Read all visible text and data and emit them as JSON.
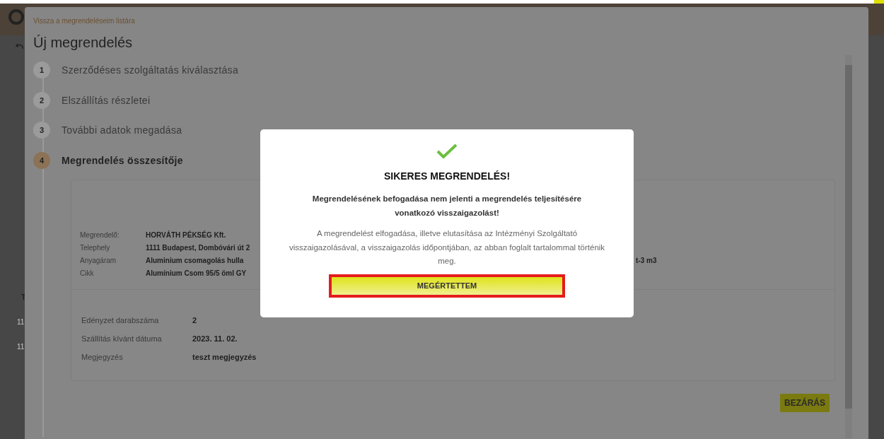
{
  "background": {
    "table_header": "T",
    "table_rows": [
      "11",
      "11"
    ]
  },
  "dialog": {
    "back_link": "Vissza a megrendeléseim listára",
    "title": "Új megrendelés",
    "steps": [
      {
        "number": "1",
        "label": "Szerződéses szolgáltatás kiválasztása",
        "selected": false
      },
      {
        "number": "2",
        "label": "Elszállítás részletei",
        "selected": false
      },
      {
        "number": "3",
        "label": "További adatok megadása",
        "selected": false
      },
      {
        "number": "4",
        "label": "Megrendelés összesítője",
        "selected": true
      }
    ],
    "summary": [
      {
        "label": "Megrendelő:",
        "value": "HORVÁTH PÉKSÉG Kft."
      },
      {
        "label": "Telephely",
        "value": "1111 Budapest, Dombóvári út 2"
      },
      {
        "label": "Anyagáram",
        "value": "Aluminium csomagolás hulla",
        "value_end": "t-3 m3"
      },
      {
        "label": "Cikk",
        "value": "Alumínium Csom 95/5 öml GY"
      }
    ],
    "details": [
      {
        "label": "Edényzet darabszáma",
        "value": "2"
      },
      {
        "label": "Szállítás kívánt dátuma",
        "value": "2023. 11. 02."
      },
      {
        "label": "Megjegyzés",
        "value": "teszt megjegyzés"
      }
    ],
    "close_button": "BEZÁRÁS"
  },
  "modal": {
    "title": "SIKERES MEGRENDELÉS!",
    "notice": "Megrendelésének befogadása nem jelenti a megrendelés teljesítésére vonatkozó visszaigazolást!",
    "text": "A megrendelést elfogadása, illetve elutasítása az Intézményi Szolgáltató visszaigazolásával, a visszaigazolás időpontjában, az abban foglalt tartalommal történik meg.",
    "button": "MEGÉRTETTEM",
    "button_highlighted": true
  }
}
